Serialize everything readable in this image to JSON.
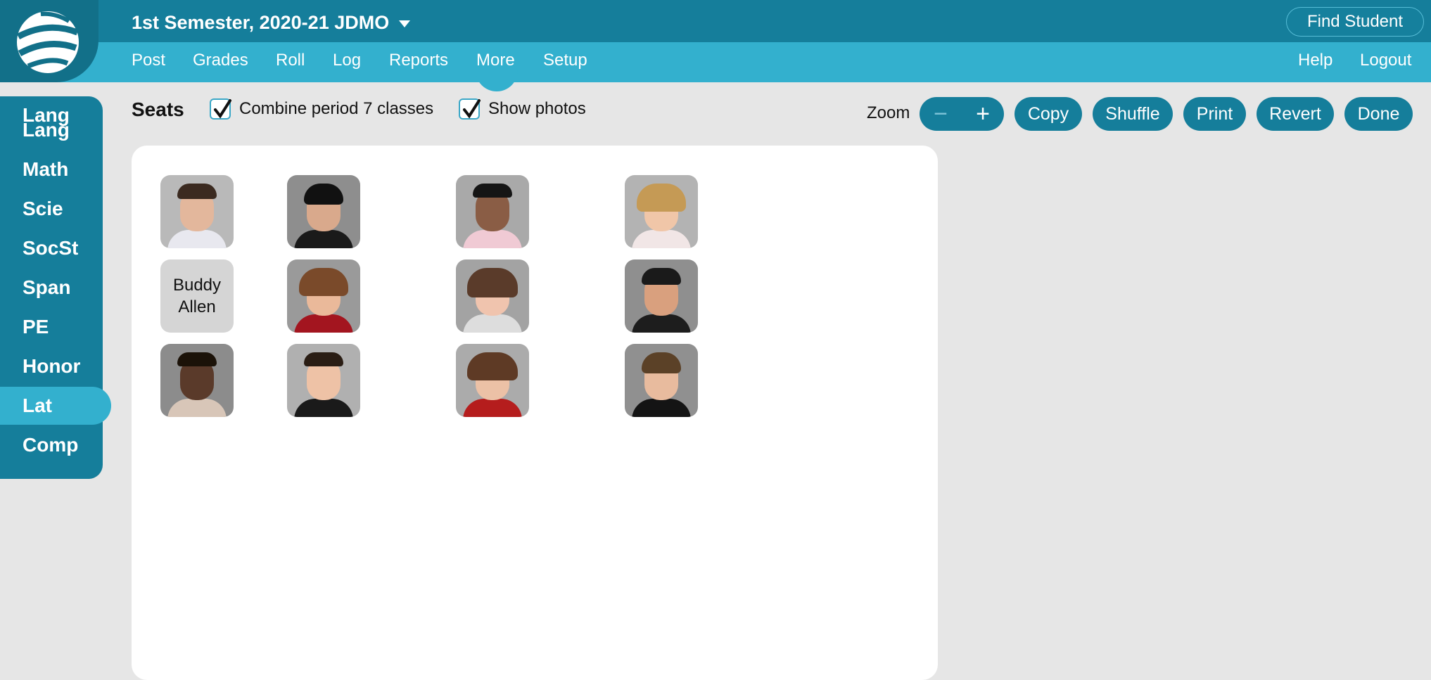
{
  "header": {
    "semester": "1st Semester, 2020-21 JDMO",
    "find_student": "Find Student"
  },
  "nav": {
    "items": [
      "Post",
      "Grades",
      "Roll",
      "Log",
      "Reports",
      "More",
      "Setup"
    ],
    "active": "More",
    "right": [
      "Help",
      "Logout"
    ]
  },
  "sidebar": {
    "items": [
      "Lang",
      "Math",
      "Scie",
      "SocSt",
      "Span",
      "PE",
      "Honor",
      "Lat",
      "Comp"
    ],
    "active": "Lat"
  },
  "toolbar": {
    "title": "Seats",
    "combine_label": "Combine period 7 classes",
    "combine_checked": true,
    "photos_label": "Show photos",
    "photos_checked": true,
    "zoom_label": "Zoom",
    "zoom_minus": "−",
    "zoom_plus": "+",
    "buttons": [
      "Copy",
      "Shuffle",
      "Print",
      "Revert",
      "Done"
    ]
  },
  "seats": [
    {
      "photo": true,
      "name": ""
    },
    {
      "photo": true,
      "name": ""
    },
    {
      "photo": true,
      "name": ""
    },
    {
      "photo": true,
      "name": ""
    },
    {
      "photo": false,
      "name": "Buddy Allen"
    },
    {
      "photo": true,
      "name": ""
    },
    {
      "photo": true,
      "name": ""
    },
    {
      "photo": true,
      "name": ""
    },
    {
      "photo": true,
      "name": ""
    },
    {
      "photo": true,
      "name": ""
    },
    {
      "photo": true,
      "name": ""
    },
    {
      "photo": true,
      "name": ""
    }
  ],
  "colors": {
    "header_dark": "#157e9b",
    "nav_light": "#33b0ce",
    "page_bg": "#e6e6e6"
  }
}
